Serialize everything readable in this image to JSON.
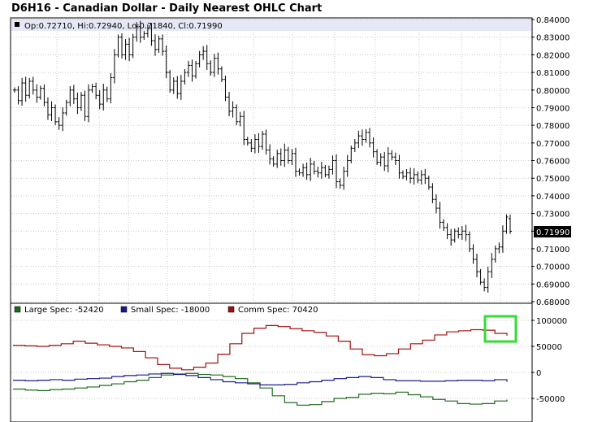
{
  "title": "D6H16 - Canadian Dollar - Daily Nearest OHLC Chart",
  "ohlc_legend": "Op:0.72710, Hi:0.72940, Lo:0.71840, Cl:0.71990",
  "last_price_label": "0.71990",
  "cot_legend": [
    {
      "label": "Large Spec: -52420",
      "color": "#1e6b1e"
    },
    {
      "label": "Small Spec: -18000",
      "color": "#1a1a8c"
    },
    {
      "label": "Comm Spec: 70420",
      "color": "#a01010"
    }
  ],
  "colors": {
    "highlight": "#33dd33",
    "grid": "#c8c8c8",
    "legend_bg": "#e6e8f5"
  },
  "chart_data": [
    {
      "type": "ohlc",
      "title": "D6H16 - Canadian Dollar - Daily Nearest OHLC Chart",
      "ylim": [
        0.68,
        0.84
      ],
      "yticks": [
        "0.84000",
        "0.83000",
        "0.82000",
        "0.81000",
        "0.80000",
        "0.79000",
        "0.78000",
        "0.77000",
        "0.76000",
        "0.75000",
        "0.74000",
        "0.73000",
        "0.72000",
        "0.71000",
        "0.70000",
        "0.69000",
        "0.68000"
      ],
      "last": {
        "open": 0.7271,
        "high": 0.7294,
        "low": 0.7184,
        "close": 0.7199
      },
      "close_series": [
        0.8,
        0.794,
        0.804,
        0.797,
        0.805,
        0.8,
        0.796,
        0.801,
        0.793,
        0.786,
        0.79,
        0.782,
        0.78,
        0.787,
        0.793,
        0.8,
        0.795,
        0.79,
        0.797,
        0.785,
        0.8,
        0.802,
        0.797,
        0.792,
        0.8,
        0.795,
        0.807,
        0.82,
        0.83,
        0.82,
        0.826,
        0.82,
        0.83,
        0.836,
        0.83,
        0.832,
        0.835,
        0.828,
        0.823,
        0.829,
        0.822,
        0.81,
        0.8,
        0.805,
        0.798,
        0.805,
        0.81,
        0.814,
        0.808,
        0.815,
        0.82,
        0.822,
        0.815,
        0.81,
        0.818,
        0.812,
        0.806,
        0.796,
        0.788,
        0.79,
        0.782,
        0.785,
        0.772,
        0.77,
        0.767,
        0.772,
        0.768,
        0.775,
        0.766,
        0.761,
        0.758,
        0.764,
        0.76,
        0.766,
        0.76,
        0.764,
        0.754,
        0.753,
        0.756,
        0.752,
        0.758,
        0.754,
        0.753,
        0.756,
        0.752,
        0.755,
        0.76,
        0.748,
        0.746,
        0.754,
        0.76,
        0.767,
        0.77,
        0.774,
        0.772,
        0.776,
        0.77,
        0.765,
        0.759,
        0.762,
        0.757,
        0.764,
        0.762,
        0.76,
        0.753,
        0.751,
        0.753,
        0.75,
        0.752,
        0.749,
        0.752,
        0.75,
        0.745,
        0.738,
        0.733,
        0.725,
        0.722,
        0.718,
        0.715,
        0.72,
        0.718,
        0.72,
        0.718,
        0.71,
        0.704,
        0.697,
        0.691,
        0.688,
        0.697,
        0.704,
        0.71,
        0.711,
        0.72,
        0.728,
        0.72
      ]
    },
    {
      "type": "line",
      "title": "",
      "yticks": [
        "100000",
        "50000",
        "0",
        "-50000"
      ],
      "ylim": [
        -70000,
        100000
      ],
      "series": [
        {
          "name": "Large Spec",
          "color": "#1e6b1e",
          "values": [
            -32000,
            -34000,
            -35000,
            -33000,
            -32000,
            -30000,
            -28000,
            -25000,
            -22000,
            -18000,
            -15000,
            -10000,
            -5000,
            -3000,
            -2000,
            -4000,
            -5000,
            -8000,
            -12000,
            -20000,
            -30000,
            -45000,
            -58000,
            -63000,
            -62000,
            -56000,
            -50000,
            -48000,
            -42000,
            -40000,
            -41000,
            -38000,
            -43000,
            -47000,
            -52000,
            -55000,
            -60000,
            -61000,
            -60000,
            -55000,
            -52420
          ]
        },
        {
          "name": "Small Spec",
          "color": "#1a1a8c",
          "values": [
            -15000,
            -16000,
            -15000,
            -14000,
            -15000,
            -13000,
            -12000,
            -11000,
            -8000,
            -6000,
            -5000,
            -3000,
            -2000,
            -4000,
            -6000,
            -10000,
            -14000,
            -18000,
            -20000,
            -22000,
            -24000,
            -24000,
            -23000,
            -20000,
            -18000,
            -15000,
            -12000,
            -10000,
            -8000,
            -10000,
            -14000,
            -16000,
            -16000,
            -17000,
            -17000,
            -16000,
            -15000,
            -15000,
            -16000,
            -14000,
            -18000
          ]
        },
        {
          "name": "Comm Spec",
          "color": "#a01010",
          "values": [
            52000,
            51000,
            50000,
            52000,
            55000,
            60000,
            56000,
            53000,
            50000,
            47000,
            40000,
            28000,
            15000,
            8000,
            5000,
            10000,
            18000,
            35000,
            55000,
            75000,
            85000,
            90000,
            88000,
            84000,
            80000,
            77000,
            70000,
            60000,
            45000,
            34000,
            32000,
            36000,
            45000,
            55000,
            62000,
            72000,
            78000,
            80000,
            82000,
            81000,
            75000,
            70420
          ]
        }
      ]
    }
  ]
}
